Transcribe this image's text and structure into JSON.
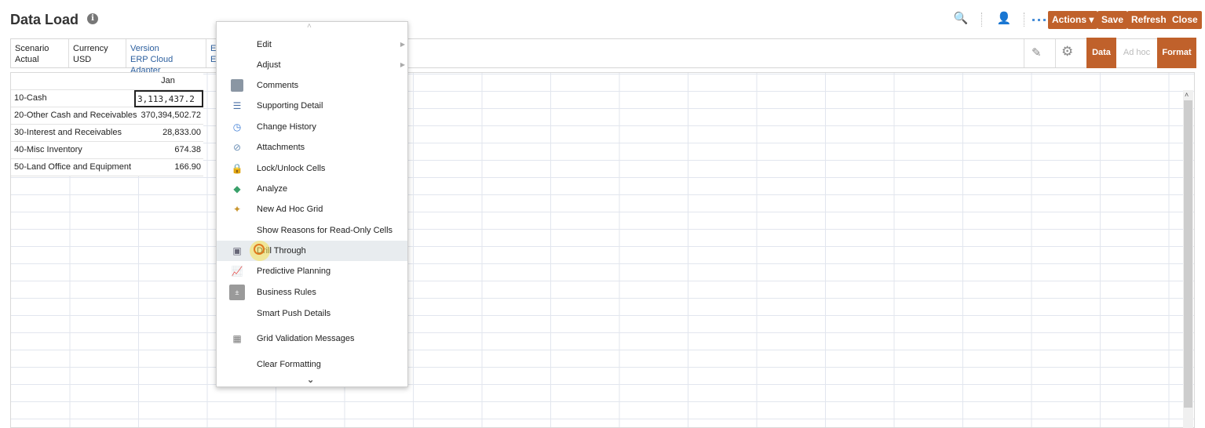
{
  "header": {
    "title": "Data Load",
    "info_icon": "info-icon",
    "buttons": {
      "actions": "Actions ▾",
      "save": "Save",
      "refresh": "Refresh",
      "close": "Close"
    },
    "accent": "#c0612b"
  },
  "pov": [
    {
      "dim": "Scenario",
      "member": "Actual"
    },
    {
      "dim": "Currency",
      "member": "USD"
    },
    {
      "dim": "Version",
      "member": "ERP Cloud Adapter"
    },
    {
      "dim": "En",
      "member": "ER"
    }
  ],
  "tabs": {
    "data": "Data",
    "adhoc": "Ad hoc",
    "format": "Format"
  },
  "grid": {
    "column": "Jan",
    "rows": [
      {
        "label": "10-Cash",
        "value": "3,113,437.2"
      },
      {
        "label": "20-Other Cash and Receivables",
        "value": "370,394,502.72"
      },
      {
        "label": "30-Interest and Receivables",
        "value": "28,833.00"
      },
      {
        "label": "40-Misc Inventory",
        "value": "674.38"
      },
      {
        "label": "50-Land Office and Equipment",
        "value": "166.90"
      }
    ]
  },
  "menu": {
    "items": [
      {
        "label": "Edit",
        "icon": "",
        "submenu": true
      },
      {
        "label": "Adjust",
        "icon": "",
        "submenu": true
      },
      {
        "label": "Comments",
        "icon": "comment-icon"
      },
      {
        "label": "Supporting Detail",
        "icon": "supporting-detail-icon"
      },
      {
        "label": "Change History",
        "icon": "history-icon"
      },
      {
        "label": "Attachments",
        "icon": "paperclip-icon"
      },
      {
        "label": "Lock/Unlock Cells",
        "icon": "lock-icon"
      },
      {
        "label": "Analyze",
        "icon": "analyze-icon"
      },
      {
        "label": "New Ad Hoc Grid",
        "icon": "adhoc-icon"
      },
      {
        "label": "Show Reasons for Read-Only Cells",
        "icon": ""
      },
      {
        "label": "Drill Through",
        "icon": "drill-icon"
      },
      {
        "label": "Predictive Planning",
        "icon": "chart-icon"
      },
      {
        "label": "Business Rules",
        "icon": "calculator-icon"
      },
      {
        "label": "Smart Push Details",
        "icon": ""
      },
      {
        "label": "Grid Validation Messages",
        "icon": "grid-check-icon"
      },
      {
        "label": "Clear Formatting",
        "icon": ""
      }
    ]
  }
}
